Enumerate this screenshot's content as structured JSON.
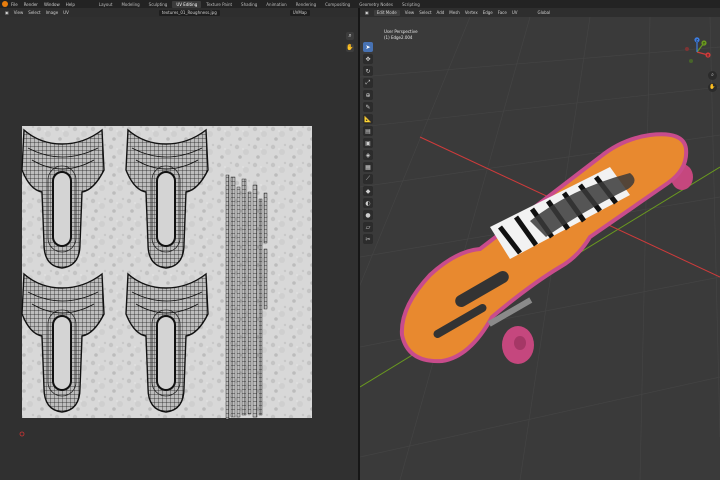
{
  "menu": [
    "File",
    "Render",
    "Window",
    "Help"
  ],
  "workspaces": [
    {
      "label": "Layout",
      "active": false
    },
    {
      "label": "Modeling",
      "active": false
    },
    {
      "label": "Sculpting",
      "active": false
    },
    {
      "label": "UV Editing",
      "active": true
    },
    {
      "label": "Texture Paint",
      "active": false
    },
    {
      "label": "Shading",
      "active": false
    },
    {
      "label": "Animation",
      "active": false
    },
    {
      "label": "Rendering",
      "active": false
    },
    {
      "label": "Compositing",
      "active": false
    },
    {
      "label": "Geometry Nodes",
      "active": false
    },
    {
      "label": "Scripting",
      "active": false
    }
  ],
  "uv_header": {
    "view": "View",
    "select": "Select",
    "image": "Image",
    "uv": "UV",
    "image_name": "textures_01_Roughness.jpg",
    "map": "UVMap"
  },
  "viewport_header": {
    "mode": "Edit Mode",
    "view": "View",
    "select": "Select",
    "add": "Add",
    "mesh": "Mesh",
    "vertex": "Vertex",
    "edge": "Edge",
    "face": "Face",
    "uv": "UV",
    "orientation": "Global"
  },
  "viewport_overlay": {
    "perspective": "User Perspective",
    "object": "(1) Edge2.004"
  },
  "icons": {
    "uv_zoom": "magnify-icon",
    "uv_pan": "hand-icon",
    "gizmo": "axis-gizmo-icon",
    "tools": [
      "cursor-icon",
      "move-icon",
      "rotate-icon",
      "scale-icon",
      "transform-icon",
      "annotate-icon",
      "measure-icon",
      "extrude-icon",
      "inset-icon",
      "bevel-icon",
      "loopcut-icon",
      "knife-icon",
      "polybuild-icon",
      "spin-icon",
      "smooth-icon",
      "shear-icon",
      "rip-icon"
    ]
  },
  "colors": {
    "selection": "#e8892f",
    "board_edge": "#c84c8c",
    "wheel": "#c5477e",
    "accent": "#4772b3",
    "axis_x": "#cf3b3b",
    "axis_y": "#6a9a1f",
    "axis_z": "#3d7de0"
  },
  "gizmo_axes": {
    "x": "X",
    "y": "Y",
    "z": "Z"
  }
}
